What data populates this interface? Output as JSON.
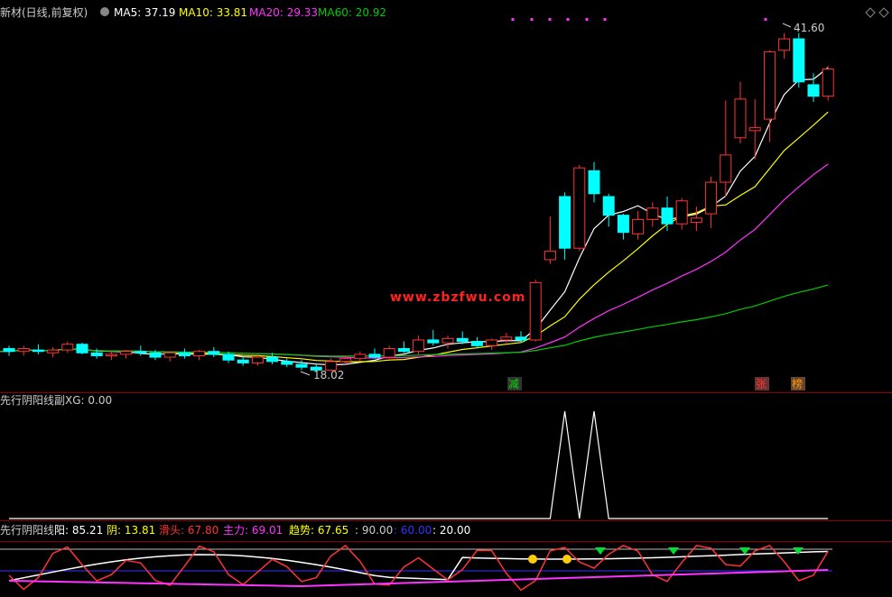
{
  "main_panel": {
    "title": "新材(日线,前复权)",
    "ma_legend": [
      {
        "label": "MA5: 37.19",
        "color": "#ffffff"
      },
      {
        "label": "MA10: 33.81",
        "color": "#ffff00"
      },
      {
        "label": "MA20: 29.33",
        "color": "#ff33ff"
      },
      {
        "label": "MA60: 20.92",
        "color": "#00cc00"
      }
    ],
    "watermark": "www.zbzfwu.com",
    "high_label": "41.60",
    "low_label": "18.02",
    "signals": [
      {
        "text": "减",
        "color": "#00dd00",
        "bg": "#333333"
      },
      {
        "text": "张",
        "color": "#ff3333",
        "bg": "#663333"
      },
      {
        "text": "榜",
        "color": "#ff9900",
        "bg": "#664433"
      }
    ]
  },
  "sub_panel1": {
    "title": "先行阴阳线副",
    "value_label": "XG: 0.00"
  },
  "sub_panel2": {
    "title": "先行阴阳线",
    "legend": [
      {
        "label": "阳: 85.21",
        "color": "#ffffff"
      },
      {
        "label": "阴: 13.81",
        "color": "#ffff00"
      },
      {
        "label": "滑头: 67.80",
        "color": "#ff3333"
      },
      {
        "label": "主力: 69.01",
        "color": "#ff33ff"
      },
      {
        "label": "趋势: 67.65",
        "color": "#ffff00"
      },
      {
        "label": ": 90.00",
        "color": "#cccccc"
      },
      {
        "label": ": 60.00",
        "color": "#3333ff"
      },
      {
        "label": ": 20.00",
        "color": "#ffffff"
      }
    ]
  },
  "chart_data": [
    {
      "type": "candlestick",
      "title": "新材(日线,前复权)",
      "ohlc": [
        [
          19.6,
          19.8,
          19.1,
          19.4
        ],
        [
          19.4,
          19.8,
          19.1,
          19.6
        ],
        [
          19.5,
          19.9,
          19.2,
          19.4
        ],
        [
          19.3,
          19.7,
          19.0,
          19.5
        ],
        [
          19.5,
          20.1,
          19.3,
          19.9
        ],
        [
          19.9,
          20.0,
          19.2,
          19.3
        ],
        [
          19.3,
          19.6,
          18.9,
          19.1
        ],
        [
          19.1,
          19.4,
          18.8,
          19.2
        ],
        [
          19.2,
          19.5,
          18.9,
          19.4
        ],
        [
          19.4,
          19.8,
          19.1,
          19.3
        ],
        [
          19.3,
          19.5,
          18.8,
          19.0
        ],
        [
          19.0,
          19.4,
          18.7,
          19.3
        ],
        [
          19.3,
          19.6,
          18.9,
          19.1
        ],
        [
          19.1,
          19.5,
          18.8,
          19.4
        ],
        [
          19.4,
          19.7,
          19.0,
          19.2
        ],
        [
          19.2,
          19.4,
          18.6,
          18.8
        ],
        [
          18.8,
          19.0,
          18.4,
          18.6
        ],
        [
          18.6,
          19.2,
          18.4,
          19.0
        ],
        [
          19.0,
          19.3,
          18.5,
          18.7
        ],
        [
          18.7,
          18.9,
          18.3,
          18.5
        ],
        [
          18.5,
          18.8,
          18.1,
          18.3
        ],
        [
          18.3,
          18.5,
          18.0,
          18.1
        ],
        [
          18.1,
          18.9,
          18.02,
          18.7
        ],
        [
          18.7,
          19.1,
          18.5,
          18.9
        ],
        [
          18.9,
          19.4,
          18.7,
          19.2
        ],
        [
          19.2,
          19.6,
          18.9,
          19.0
        ],
        [
          19.0,
          19.8,
          18.9,
          19.6
        ],
        [
          19.6,
          20.1,
          19.3,
          19.4
        ],
        [
          19.4,
          20.5,
          19.2,
          20.2
        ],
        [
          20.2,
          20.9,
          19.8,
          20.0
        ],
        [
          20.0,
          20.5,
          19.6,
          20.3
        ],
        [
          20.3,
          20.8,
          19.9,
          20.1
        ],
        [
          20.1,
          20.4,
          19.6,
          19.8
        ],
        [
          19.8,
          20.3,
          19.5,
          20.2
        ],
        [
          20.2,
          20.7,
          20.0,
          20.4
        ],
        [
          20.4,
          20.8,
          20.0,
          20.2
        ],
        [
          20.2,
          24.4,
          20.1,
          24.2
        ],
        [
          25.8,
          28.8,
          25.5,
          26.4
        ],
        [
          30.2,
          30.5,
          25.8,
          26.6
        ],
        [
          26.6,
          32.4,
          26.4,
          32.2
        ],
        [
          32.0,
          32.6,
          29.8,
          30.4
        ],
        [
          30.2,
          30.4,
          28.1,
          28.9
        ],
        [
          28.9,
          29.0,
          27.2,
          27.7
        ],
        [
          27.6,
          29.2,
          27.2,
          28.6
        ],
        [
          28.6,
          29.8,
          28.1,
          29.4
        ],
        [
          29.4,
          30.2,
          27.8,
          28.3
        ],
        [
          28.3,
          30.1,
          27.9,
          29.9
        ],
        [
          28.4,
          29.5,
          27.8,
          28.7
        ],
        [
          29.0,
          31.6,
          28.0,
          31.2
        ],
        [
          31.2,
          36.9,
          30.2,
          33.1
        ],
        [
          34.3,
          38.2,
          33.9,
          37.0
        ],
        [
          34.8,
          37.0,
          32.8,
          35.0
        ],
        [
          35.6,
          40.4,
          34.0,
          40.3
        ],
        [
          40.4,
          41.6,
          39.8,
          41.2
        ],
        [
          41.2,
          41.6,
          37.8,
          38.2
        ],
        [
          38.0,
          38.8,
          36.8,
          37.2
        ],
        [
          37.2,
          39.3,
          36.9,
          39.1
        ]
      ],
      "series": [
        {
          "name": "MA5",
          "color": "#ffffff"
        },
        {
          "name": "MA10",
          "color": "#ffff00"
        },
        {
          "name": "MA20",
          "color": "#ff33ff"
        },
        {
          "name": "MA60",
          "color": "#00cc00"
        }
      ],
      "annotations": [
        "41.60",
        "18.02",
        "www.zbzfwu.com"
      ]
    },
    {
      "type": "line",
      "title": "先行阴阳线副",
      "series": [
        {
          "name": "XG",
          "color": "#ffffff",
          "values": [
            0,
            0,
            0,
            0,
            0,
            0,
            0,
            0,
            0,
            0,
            0,
            0,
            0,
            0,
            0,
            0,
            0,
            0,
            0,
            0,
            0,
            0,
            0,
            0,
            0,
            0,
            0,
            0,
            0,
            0,
            0,
            0,
            0,
            0,
            0,
            0,
            0,
            0,
            1,
            0,
            1,
            0,
            0,
            0,
            0,
            0,
            0,
            0,
            0,
            0,
            0,
            0,
            0,
            0,
            0,
            0,
            0
          ]
        }
      ]
    },
    {
      "type": "line",
      "title": "先行阴阳线",
      "series": [
        {
          "name": "阳",
          "color": "#ffffff"
        },
        {
          "name": "滑头",
          "color": "#ff3333"
        },
        {
          "name": "主力",
          "color": "#ff33ff"
        }
      ],
      "reference_lines": [
        90,
        60,
        20
      ]
    }
  ]
}
